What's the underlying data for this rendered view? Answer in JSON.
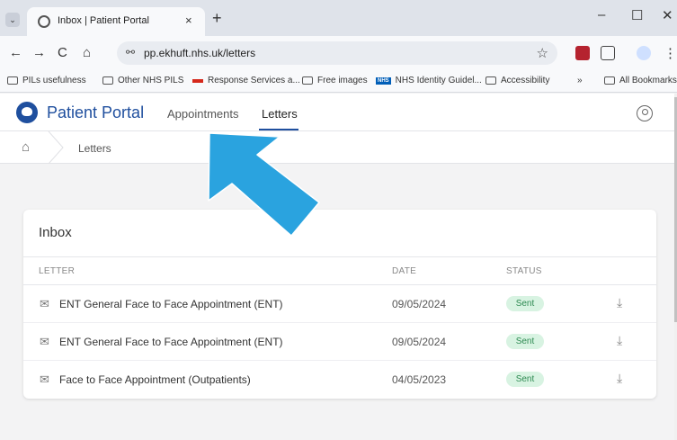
{
  "browser": {
    "tab_title": "Inbox | Patient Portal",
    "tab_close": "×",
    "new_tab": "+",
    "tab_menu": "⌄",
    "minimize": "–",
    "maximize": "☐",
    "close": "✕",
    "url": "pp.ekhuft.nhs.uk/letters",
    "back": "←",
    "forward": "→",
    "reload": "C",
    "home": "⌂",
    "star": "☆",
    "menu": "⋮"
  },
  "bookmarks": {
    "items": [
      "PILs usefulness",
      "Other NHS PILS",
      "Response Services a...",
      "Free images",
      "NHS Identity Guidel...",
      "Accessibility"
    ],
    "nhs_badge": "NHS",
    "overflow": "»",
    "all": "All Bookmarks"
  },
  "portal": {
    "name": "Patient Portal",
    "nav": [
      "Appointments",
      "Letters"
    ],
    "active_nav": "Letters"
  },
  "breadcrumb": {
    "current": "Letters"
  },
  "inbox": {
    "title": "Inbox",
    "columns": [
      "LETTER",
      "DATE",
      "STATUS"
    ],
    "rows": [
      {
        "letter": "ENT General Face to Face Appointment (ENT)",
        "date": "09/05/2024",
        "status": "Sent"
      },
      {
        "letter": "ENT General Face to Face Appointment (ENT)",
        "date": "09/05/2024",
        "status": "Sent"
      },
      {
        "letter": "Face to Face Appointment (Outpatients)",
        "date": "04/05/2023",
        "status": "Sent"
      }
    ]
  },
  "colors": {
    "brand": "#1f4f9e",
    "status_bg": "#d8f3e2",
    "status_text": "#2e8a52",
    "arrow": "#2aa3df"
  }
}
